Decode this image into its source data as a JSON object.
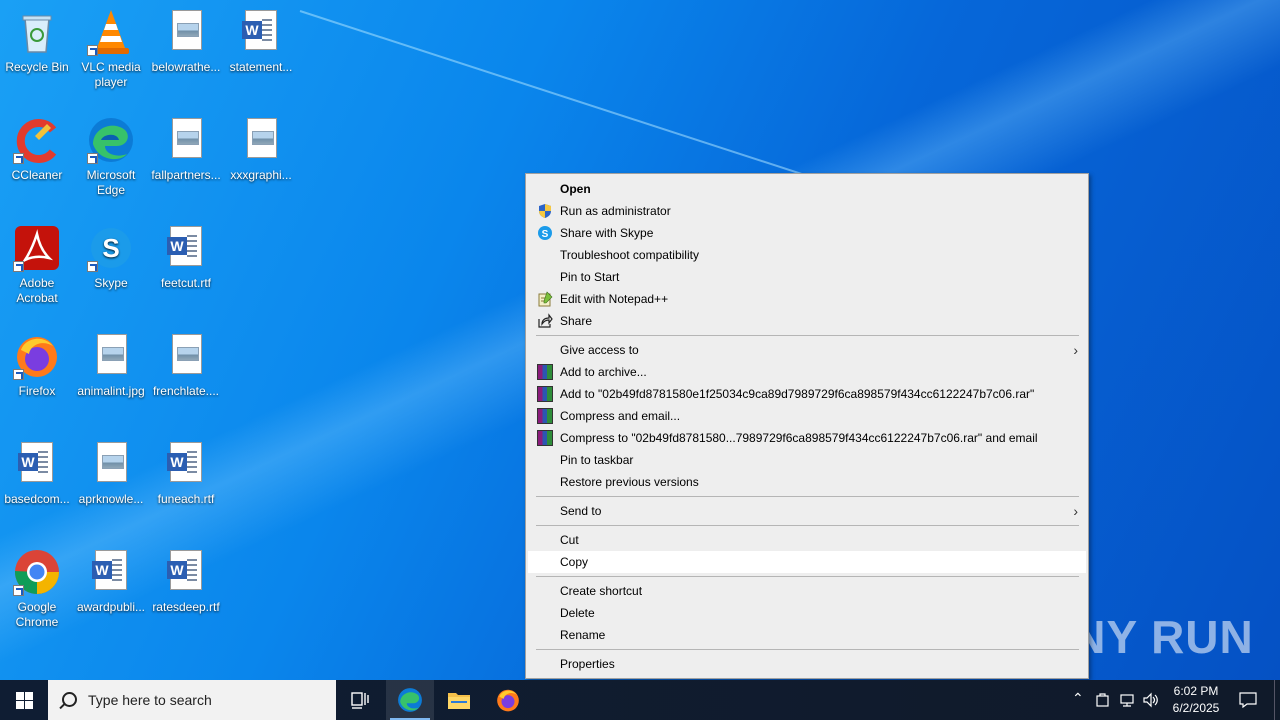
{
  "desktop": {
    "icons": [
      {
        "label": "Recycle Bin",
        "icon": "recycle-bin-icon"
      },
      {
        "label": "VLC media player",
        "icon": "vlc-icon"
      },
      {
        "label": "belowrathe...",
        "icon": "image-file-icon"
      },
      {
        "label": "statement...",
        "icon": "word-doc-icon"
      },
      {
        "label": "CCleaner",
        "icon": "ccleaner-icon"
      },
      {
        "label": "Microsoft Edge",
        "icon": "edge-icon"
      },
      {
        "label": "fallpartners...",
        "icon": "image-file-icon"
      },
      {
        "label": "xxxgraphi...",
        "icon": "image-file-icon"
      },
      {
        "label": "Adobe Acrobat",
        "icon": "acrobat-icon"
      },
      {
        "label": "Skype",
        "icon": "skype-icon"
      },
      {
        "label": "feetcut.rtf",
        "icon": "word-doc-icon"
      },
      {
        "label": "Firefox",
        "icon": "firefox-icon"
      },
      {
        "label": "animalint.jpg",
        "icon": "image-file-icon"
      },
      {
        "label": "frenchlate....",
        "icon": "image-file-icon"
      },
      {
        "label": "basedcom...",
        "icon": "word-doc-icon"
      },
      {
        "label": "aprknowle...",
        "icon": "image-file-icon"
      },
      {
        "label": "funeach.rtf",
        "icon": "word-doc-icon"
      },
      {
        "label": "Google Chrome",
        "icon": "chrome-icon"
      },
      {
        "label": "awardpubli...",
        "icon": "word-doc-icon"
      },
      {
        "label": "ratesdeep.rtf",
        "icon": "word-doc-icon"
      }
    ]
  },
  "context_menu": {
    "items": [
      {
        "label": "Open"
      },
      {
        "label": "Run as administrator"
      },
      {
        "label": "Share with Skype"
      },
      {
        "label": "Troubleshoot compatibility"
      },
      {
        "label": "Pin to Start"
      },
      {
        "label": "Edit with Notepad++"
      },
      {
        "label": "Share"
      },
      {
        "label": "Give access to"
      },
      {
        "label": "Add to archive..."
      },
      {
        "label": "Add to \"02b49fd8781580e1f25034c9ca89d7989729f6ca898579f434cc6122247b7c06.rar\""
      },
      {
        "label": "Compress and email..."
      },
      {
        "label": "Compress to \"02b49fd8781580...7989729f6ca898579f434cc6122247b7c06.rar\" and email"
      },
      {
        "label": "Pin to taskbar"
      },
      {
        "label": "Restore previous versions"
      },
      {
        "label": "Send to"
      },
      {
        "label": "Cut"
      },
      {
        "label": "Copy"
      },
      {
        "label": "Create shortcut"
      },
      {
        "label": "Delete"
      },
      {
        "label": "Rename"
      },
      {
        "label": "Properties"
      }
    ],
    "highlighted": "Copy"
  },
  "watermark": {
    "text": "ANY RUN"
  },
  "taskbar": {
    "search_placeholder": "Type here to search",
    "pinned": [
      "task-view-icon",
      "edge-icon",
      "file-explorer-icon",
      "firefox-icon"
    ],
    "clock_time": "6:02 PM",
    "clock_date": "6/2/2025"
  },
  "colors": {
    "taskbar": "#101a2a",
    "menu_bg": "#eeeeee",
    "menu_highlight": "#ffffff"
  }
}
